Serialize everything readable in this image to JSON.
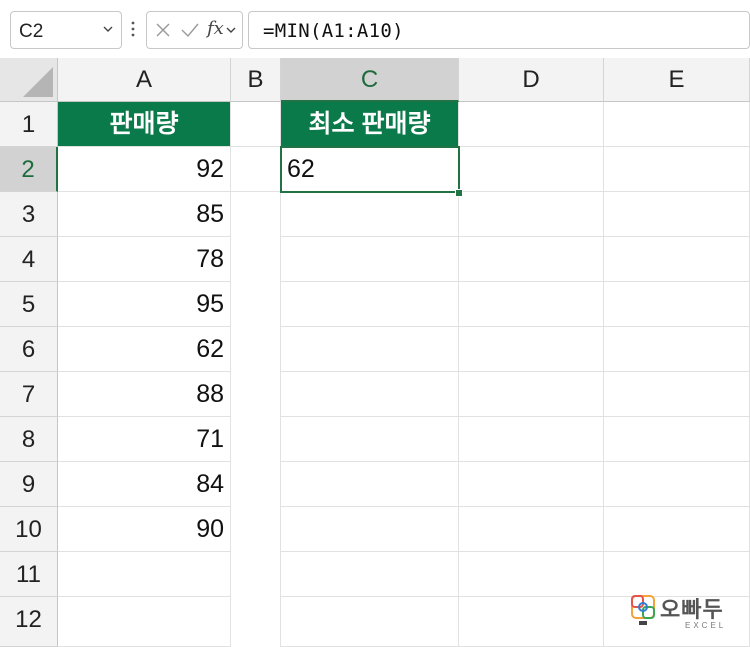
{
  "name_box": {
    "value": "C2"
  },
  "formula_bar": {
    "fx_label": "fx",
    "formula": "=MIN(A1:A10)"
  },
  "columns": [
    "A",
    "B",
    "C",
    "D",
    "E"
  ],
  "selected_column": "C",
  "rows": [
    "1",
    "2",
    "3",
    "4",
    "5",
    "6",
    "7",
    "8",
    "9",
    "10",
    "11",
    "12"
  ],
  "selected_row": "2",
  "cells": {
    "A1": "판매량",
    "C1": "최소 판매량",
    "C2": "62",
    "A_values": [
      "92",
      "85",
      "78",
      "95",
      "62",
      "88",
      "71",
      "84",
      "90"
    ]
  },
  "colors": {
    "header_fill": "#0b7a4b",
    "selection": "#217346"
  },
  "logo": {
    "korean": "오빠두",
    "english": "EXCEL"
  },
  "icons": [
    "chevron-down-icon",
    "more-options-icon",
    "cancel-icon",
    "enter-icon",
    "fx-icon",
    "select-all-icon",
    "logo-icon"
  ]
}
